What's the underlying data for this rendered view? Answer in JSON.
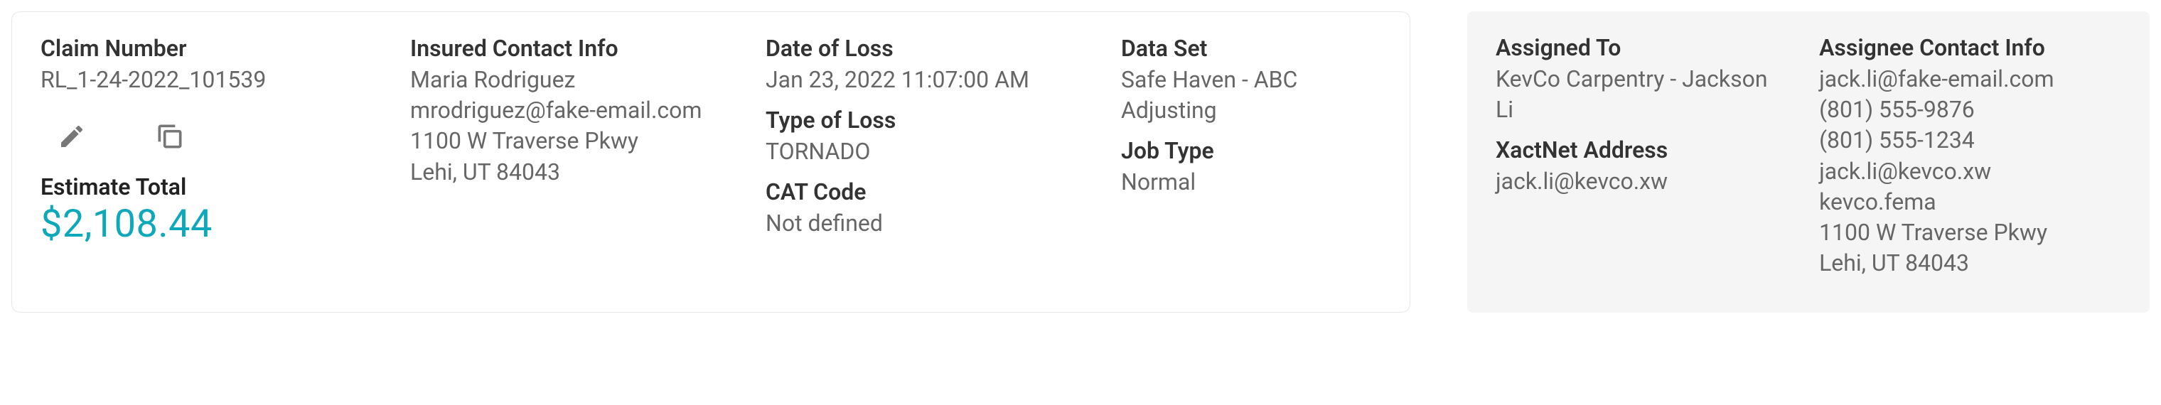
{
  "claim": {
    "number_label": "Claim Number",
    "number_value": "RL_1-24-2022_101539",
    "estimate_total_label": "Estimate Total",
    "estimate_total_value": "$2,108.44"
  },
  "insured": {
    "label": "Insured Contact Info",
    "name": "Maria Rodriguez",
    "email": "mrodriguez@fake-email.com",
    "address1": "1100 W Traverse Pkwy",
    "address2": "Lehi, UT 84043"
  },
  "loss": {
    "date_label": "Date of Loss",
    "date_value": "Jan 23, 2022 11:07:00 AM",
    "type_label": "Type of Loss",
    "type_value": "TORNADO",
    "cat_label": "CAT Code",
    "cat_value": "Not defined"
  },
  "dataset": {
    "label": "Data Set",
    "value": "Safe Haven - ABC Adjusting",
    "jobtype_label": "Job Type",
    "jobtype_value": "Normal"
  },
  "assigned": {
    "label": "Assigned To",
    "value": "KevCo Carpentry - Jackson Li",
    "xact_label": "XactNet Address",
    "xact_value": "jack.li@kevco.xw"
  },
  "assignee": {
    "label": "Assignee Contact Info",
    "email": "jack.li@fake-email.com",
    "phone1": "(801) 555-9876",
    "phone2": "(801) 555-1234",
    "xact": "jack.li@kevco.xw",
    "fema": "kevco.fema",
    "address1": "1100 W Traverse Pkwy",
    "address2": "Lehi, UT 84043"
  },
  "icons": {
    "edit": "edit",
    "copy": "copy"
  }
}
